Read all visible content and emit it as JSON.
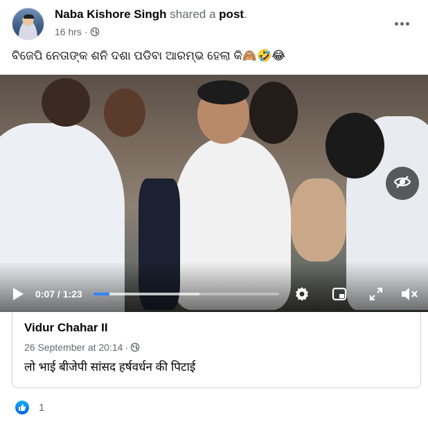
{
  "post": {
    "author": "Naba Kishore Singh",
    "shared_word": "shared a",
    "post_word": "post",
    "period": ".",
    "time": "16 hrs",
    "separator": "·",
    "privacy_icon": "globe-icon",
    "text": "ବିଜେପି ନେତାଙ୍କ ଶନି ଦଶା ପଡିବା ଆରମ୍ଭ ହେଲା କି🙈🤣😂"
  },
  "video": {
    "current_time": "0:07",
    "duration": "1:23",
    "time_display": "0:07 / 1:23",
    "progress_fraction": 0.084,
    "buffered_fraction": 0.57,
    "icons": [
      "hide-icon",
      "play-icon",
      "settings-icon",
      "miniplayer-icon",
      "fullscreen-icon",
      "mute-icon"
    ]
  },
  "shared": {
    "author": "Vidur Chahar II",
    "date": "26 September at 20:14",
    "separator": "·",
    "text": "लो भाई बीजेपी सांसद हर्षवर्धन की पिटाई"
  },
  "reactions": {
    "count": "1",
    "icon": "like-icon",
    "colors": {
      "like": "#1877f2",
      "progress": "#2d88ff"
    }
  }
}
